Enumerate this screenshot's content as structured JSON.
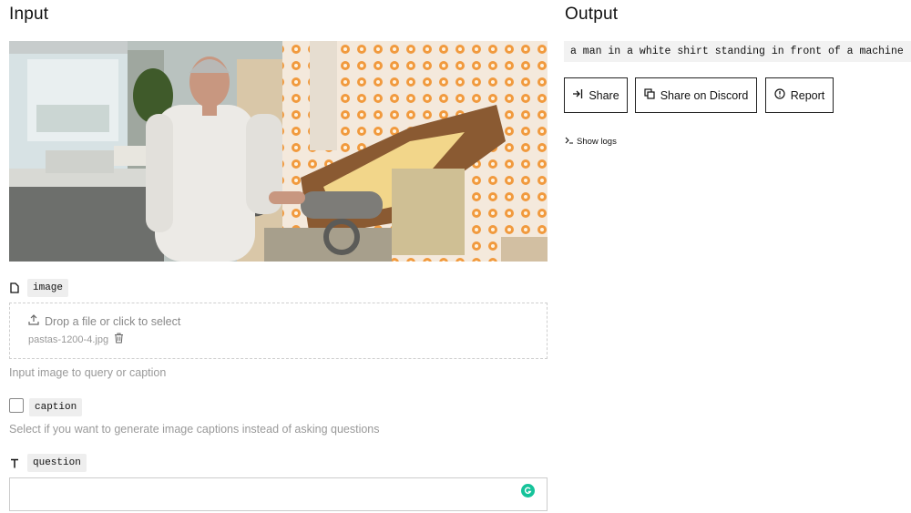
{
  "input": {
    "heading": "Input",
    "image_field": {
      "label": "image",
      "drop_text": "Drop a file or click to select",
      "file_name": "pastas-1200-4.jpg",
      "help": "Input image to query or caption"
    },
    "caption_field": {
      "label": "caption",
      "checked": false,
      "help": "Select if you want to generate image captions instead of asking questions"
    },
    "question_field": {
      "label": "question",
      "value": ""
    }
  },
  "output": {
    "heading": "Output",
    "text": "a man in a white shirt standing in front of a machine",
    "buttons": {
      "share": "Share",
      "discord": "Share on Discord",
      "report": "Report"
    },
    "show_logs": "Show logs"
  },
  "icons": {
    "image_field": "file-icon",
    "question_field": "text-t-icon",
    "upload": "upload-icon",
    "delete": "trash-icon",
    "share": "share-arrow-icon",
    "discord": "copy-icon",
    "report": "alert-circle-icon",
    "logs": "terminal-prompt-icon",
    "grammarly": "grammarly-icon"
  },
  "colors": {
    "grammarly": "#15c39a",
    "output_bg": "#f2f2f2"
  }
}
